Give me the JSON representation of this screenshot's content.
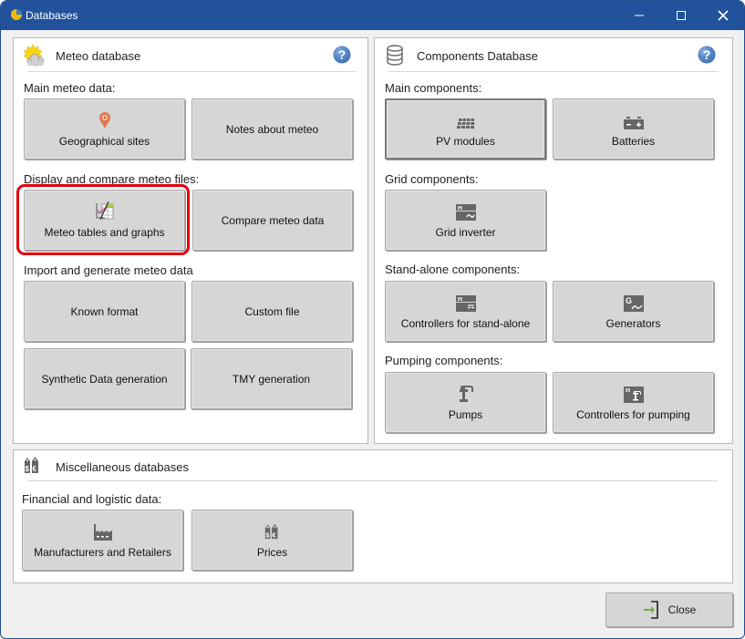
{
  "window": {
    "title": "Databases",
    "controls": {
      "minimize": "minimize",
      "maximize": "maximize",
      "close": "close"
    }
  },
  "meteo": {
    "title": "Meteo database",
    "icon": "sun-cloud-icon",
    "help_icon": "help-icon",
    "sections": [
      {
        "label": "Main meteo data:",
        "buttons": [
          {
            "label": "Geographical sites",
            "icon": "map-pin-icon"
          },
          {
            "label": "Notes about meteo",
            "icon": ""
          }
        ]
      },
      {
        "label": "Display and compare meteo files:",
        "buttons": [
          {
            "label": "Meteo tables and graphs",
            "icon": "table-graph-icon",
            "highlighted": true
          },
          {
            "label": "Compare meteo data",
            "icon": ""
          }
        ]
      },
      {
        "label": "Import and generate meteo data",
        "buttons": [
          {
            "label": "Known format",
            "icon": ""
          },
          {
            "label": "Custom file",
            "icon": ""
          },
          {
            "label": "Synthetic Data generation",
            "icon": ""
          },
          {
            "label": "TMY generation",
            "icon": ""
          }
        ]
      }
    ]
  },
  "components": {
    "title": "Components Database",
    "icon": "database-icon",
    "help_icon": "help-icon",
    "sections": [
      {
        "label": "Main components:",
        "buttons": [
          {
            "label": "PV modules",
            "icon": "pv-module-icon",
            "focused": true
          },
          {
            "label": "Batteries",
            "icon": "battery-icon"
          }
        ]
      },
      {
        "label": "Grid components:",
        "buttons": [
          {
            "label": "Grid inverter",
            "icon": "inverter-icon"
          }
        ]
      },
      {
        "label": "Stand-alone components:",
        "buttons": [
          {
            "label": "Controllers for stand-alone",
            "icon": "controller-icon"
          },
          {
            "label": "Generators",
            "icon": "generator-icon"
          }
        ]
      },
      {
        "label": "Pumping components:",
        "buttons": [
          {
            "label": "Pumps",
            "icon": "pump-icon"
          },
          {
            "label": "Controllers for pumping",
            "icon": "pump-controller-icon"
          }
        ]
      }
    ]
  },
  "misc": {
    "title": "Miscellaneous databases",
    "icon": "price-tag-icon",
    "sections": [
      {
        "label": "Financial and logistic data:",
        "buttons": [
          {
            "label": "Manufacturers and Retailers",
            "icon": "factory-icon"
          },
          {
            "label": "Prices",
            "icon": "price-tag-icon"
          }
        ]
      }
    ]
  },
  "footer": {
    "close_label": "Close",
    "close_icon": "exit-icon"
  },
  "colors": {
    "titlebar": "#22529b",
    "highlight": "#e3000f",
    "button_bg": "#d6d6d6",
    "help_blue": "#4a7fc1"
  }
}
